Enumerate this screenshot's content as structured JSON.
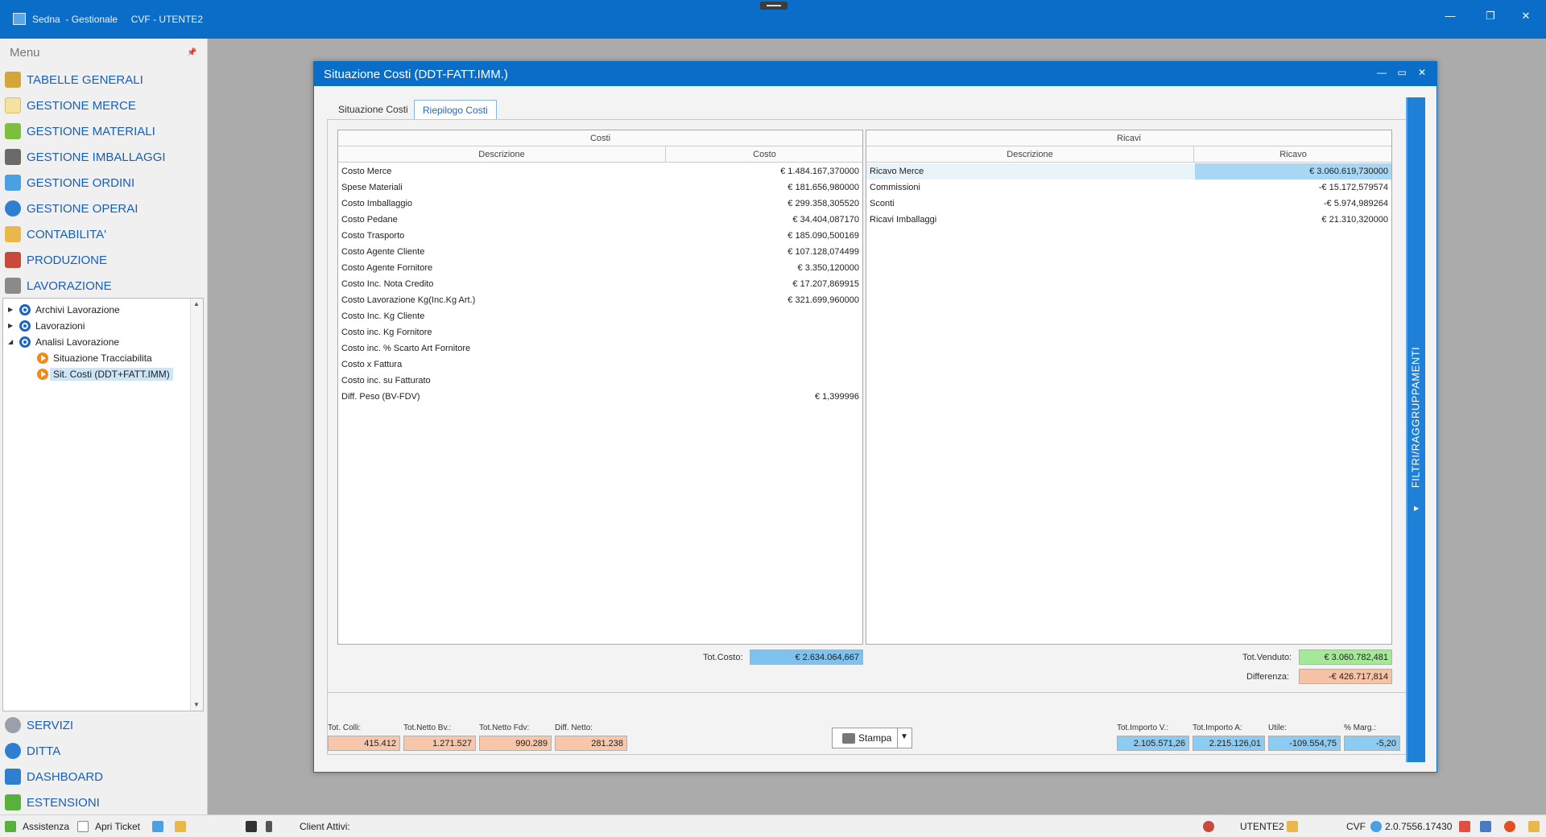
{
  "window": {
    "title": "Sedna  - Gestionale     CVF - UTENTE2",
    "minimize": "—",
    "restore": "❐",
    "close": "✕"
  },
  "sidebar": {
    "menu_title": "Menu",
    "pin": "📌",
    "items": [
      {
        "label": "TABELLE GENERALI",
        "icon": "tables-icon",
        "color": "#d4a63a"
      },
      {
        "label": "GESTIONE MERCE",
        "icon": "merce-icon",
        "color": "#f3e2a0"
      },
      {
        "label": "GESTIONE MATERIALI",
        "icon": "materials-icon",
        "color": "#7cbf3c"
      },
      {
        "label": "GESTIONE IMBALLAGGI",
        "icon": "packaging-icon",
        "color": "#6a6a6a"
      },
      {
        "label": "GESTIONE ORDINI",
        "icon": "orders-icon",
        "color": "#4aa0e0"
      },
      {
        "label": "GESTIONE OPERAI",
        "icon": "workers-icon",
        "color": "#2e7fd0"
      },
      {
        "label": "CONTABILITA'",
        "icon": "accounting-icon",
        "color": "#e8b84a"
      },
      {
        "label": "PRODUZIONE",
        "icon": "production-icon",
        "color": "#c84a3a"
      },
      {
        "label": "LAVORAZIONE",
        "icon": "processing-icon",
        "color": "#8a8a8a"
      }
    ],
    "bottom_items": [
      {
        "label": "SERVIZI",
        "icon": "services-icon",
        "color": "#9aa0aa"
      },
      {
        "label": "DITTA",
        "icon": "info-icon",
        "color": "#2e7fd0"
      },
      {
        "label": "DASHBOARD",
        "icon": "dashboard-icon",
        "color": "#2e7fd0"
      },
      {
        "label": "ESTENSIONI",
        "icon": "extensions-icon",
        "color": "#5ab03c"
      }
    ],
    "tree": [
      {
        "label": "Archivi Lavorazione",
        "level": 0,
        "expander": "▶",
        "icon": "blue"
      },
      {
        "label": "Lavorazioni",
        "level": 0,
        "expander": "▶",
        "icon": "blue"
      },
      {
        "label": "Analisi Lavorazione",
        "level": 0,
        "expander": "◢",
        "icon": "blue"
      },
      {
        "label": "Situazione Tracciabilita",
        "level": 1,
        "expander": "",
        "icon": "orange"
      },
      {
        "label": "Sit. Costi (DDT+FATT.IMM)",
        "level": 1,
        "expander": "",
        "icon": "orange",
        "selected": true
      }
    ]
  },
  "statusbar": {
    "assistenza": "Assistenza",
    "apri_ticket": "Apri Ticket",
    "client_attivi": "Client Attivi:",
    "user": "UTENTE2",
    "company": "CVF",
    "version": "2.0.7556.17430"
  },
  "dialog": {
    "title": "Situazione Costi (DDT-FATT.IMM.)",
    "tabs": [
      "Situazione Costi",
      "Riepilogo Costi"
    ],
    "active_tab": 1,
    "costi": {
      "header": "Costi",
      "col_desc": "Descrizione",
      "col_val": "Costo",
      "rows": [
        {
          "desc": "Costo Merce",
          "val": "€ 1.484.167,370000"
        },
        {
          "desc": "Spese Materiali",
          "val": "€ 181.656,980000"
        },
        {
          "desc": "Costo Imballaggio",
          "val": "€ 299.358,305520"
        },
        {
          "desc": "Costo Pedane",
          "val": "€ 34.404,087170"
        },
        {
          "desc": "Costo Trasporto",
          "val": "€ 185.090,500169"
        },
        {
          "desc": "Costo Agente Cliente",
          "val": "€ 107.128,074499"
        },
        {
          "desc": "Costo Agente Fornitore",
          "val": "€ 3.350,120000"
        },
        {
          "desc": "Costo Inc. Nota Credito",
          "val": "€ 17.207,869915"
        },
        {
          "desc": "Costo Lavorazione Kg(Inc.Kg Art.)",
          "val": "€ 321.699,960000"
        },
        {
          "desc": "Costo Inc. Kg Cliente",
          "val": ""
        },
        {
          "desc": "Costo inc. Kg Fornitore",
          "val": ""
        },
        {
          "desc": "Costo inc. % Scarto Art Fornitore",
          "val": ""
        },
        {
          "desc": "Costo x Fattura",
          "val": ""
        },
        {
          "desc": "Costo inc. su Fatturato",
          "val": ""
        },
        {
          "desc": "Diff. Peso (BV-FDV)",
          "val": "€ 1,399996"
        }
      ],
      "tot_label": "Tot.Costo:",
      "tot_value": "€ 2.634.064,667"
    },
    "ricavi": {
      "header": "Ricavi",
      "col_desc": "Descrizione",
      "col_val": "Ricavo",
      "rows": [
        {
          "desc": "Ricavo Merce",
          "val": "€ 3.060.619,730000"
        },
        {
          "desc": "Commissioni",
          "val": "-€ 15.172,579574"
        },
        {
          "desc": "Sconti",
          "val": "-€ 5.974,989264"
        },
        {
          "desc": "Ricavi Imballaggi",
          "val": "€ 21.310,320000"
        }
      ],
      "tot_label": "Tot.Venduto:",
      "tot_value": "€ 3.060.782,481",
      "diff_label": "Differenza:",
      "diff_value": "-€ 426.717,814"
    },
    "footer": {
      "left": [
        {
          "label": "Tot. Colli:",
          "value": "415.412"
        },
        {
          "label": "Tot.Netto Bv.:",
          "value": "1.271.527"
        },
        {
          "label": "Tot.Netto Fdv:",
          "value": "990.289"
        },
        {
          "label": "Diff. Netto:",
          "value": "281.238"
        }
      ],
      "right": [
        {
          "label": "Tot.Importo V.:",
          "value": "2.105.571,26"
        },
        {
          "label": "Tot.Importo A:",
          "value": "2.215.126,01"
        },
        {
          "label": "Utile:",
          "value": "-109.554,75"
        },
        {
          "label": "% Marg.:",
          "value": "-5,20"
        }
      ],
      "print_label": "Stampa"
    },
    "filter_bar": "FILTRI/RAGGRUPPAMENTI"
  },
  "colors": {
    "accent_blue": "#0a6ec8",
    "tot_cost_blue": "#7fc2ee",
    "tot_sold_green": "#a6e89a",
    "diff_salmon": "#f6c3a6",
    "footer_left_salmon": "#f8c6ab",
    "footer_right_blue": "#8ccbf2",
    "selected_row": "#a9d6f2"
  }
}
